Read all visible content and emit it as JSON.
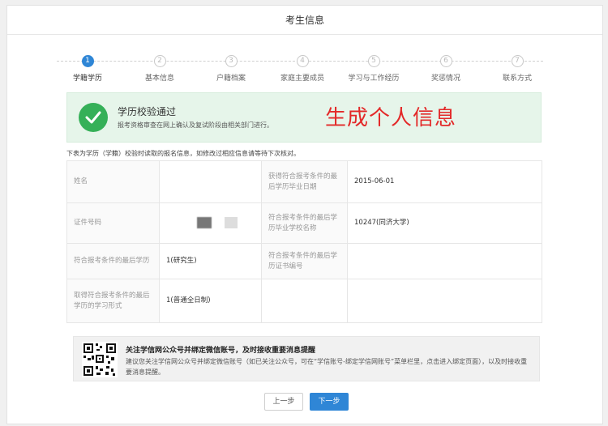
{
  "header": {
    "title": "考生信息"
  },
  "steps": [
    {
      "num": "1",
      "label": "学籍学历",
      "active": true
    },
    {
      "num": "2",
      "label": "基本信息",
      "active": false
    },
    {
      "num": "3",
      "label": "户籍档案",
      "active": false
    },
    {
      "num": "4",
      "label": "家庭主要成员",
      "active": false
    },
    {
      "num": "5",
      "label": "学习与工作经历",
      "active": false
    },
    {
      "num": "6",
      "label": "奖惩情况",
      "active": false
    },
    {
      "num": "7",
      "label": "联系方式",
      "active": false
    }
  ],
  "banner": {
    "title": "学历校验通过",
    "subtitle": "报考资格审查在网上确认及复试阶段由相关部门进行。",
    "overlay": "生成个人信息",
    "colors": {
      "bg": "#e6f5ea",
      "check": "#35b058",
      "overlay": "#e32929"
    }
  },
  "note": "下表为学历（学籍）校验时读取的报名信息，如修改过相应信息请等待下次核对。",
  "table": {
    "rows": [
      {
        "label1": "姓名",
        "value1": "",
        "label2": "获得符合报考条件的最后学历毕业日期",
        "value2": "2015-06-01"
      },
      {
        "label1": "证件号码",
        "value1": "",
        "label2": "符合报考条件的最后学历毕业学校名称",
        "value2": "10247(同济大学)"
      },
      {
        "label1": "符合报考条件的最后学历",
        "value1": "1(研究生)",
        "label2": "符合报考条件的最后学历证书编号",
        "value2": ""
      },
      {
        "label1": "取得符合报考条件的最后学历的学习形式",
        "value1": "1(普通全日制)",
        "label2": "",
        "value2": ""
      }
    ]
  },
  "wechat": {
    "title": "关注学信网公众号并绑定微信账号，及时接收重要消息提醒",
    "desc": "建议您关注学信网公众号并绑定微信账号（如已关注公众号，可在“学信账号-绑定学信网账号”菜单栏里，点击进入绑定页面），以及时接收重要消息提醒。"
  },
  "buttons": {
    "prev": "上一步",
    "next": "下一步",
    "accent": "#2f86d6"
  }
}
